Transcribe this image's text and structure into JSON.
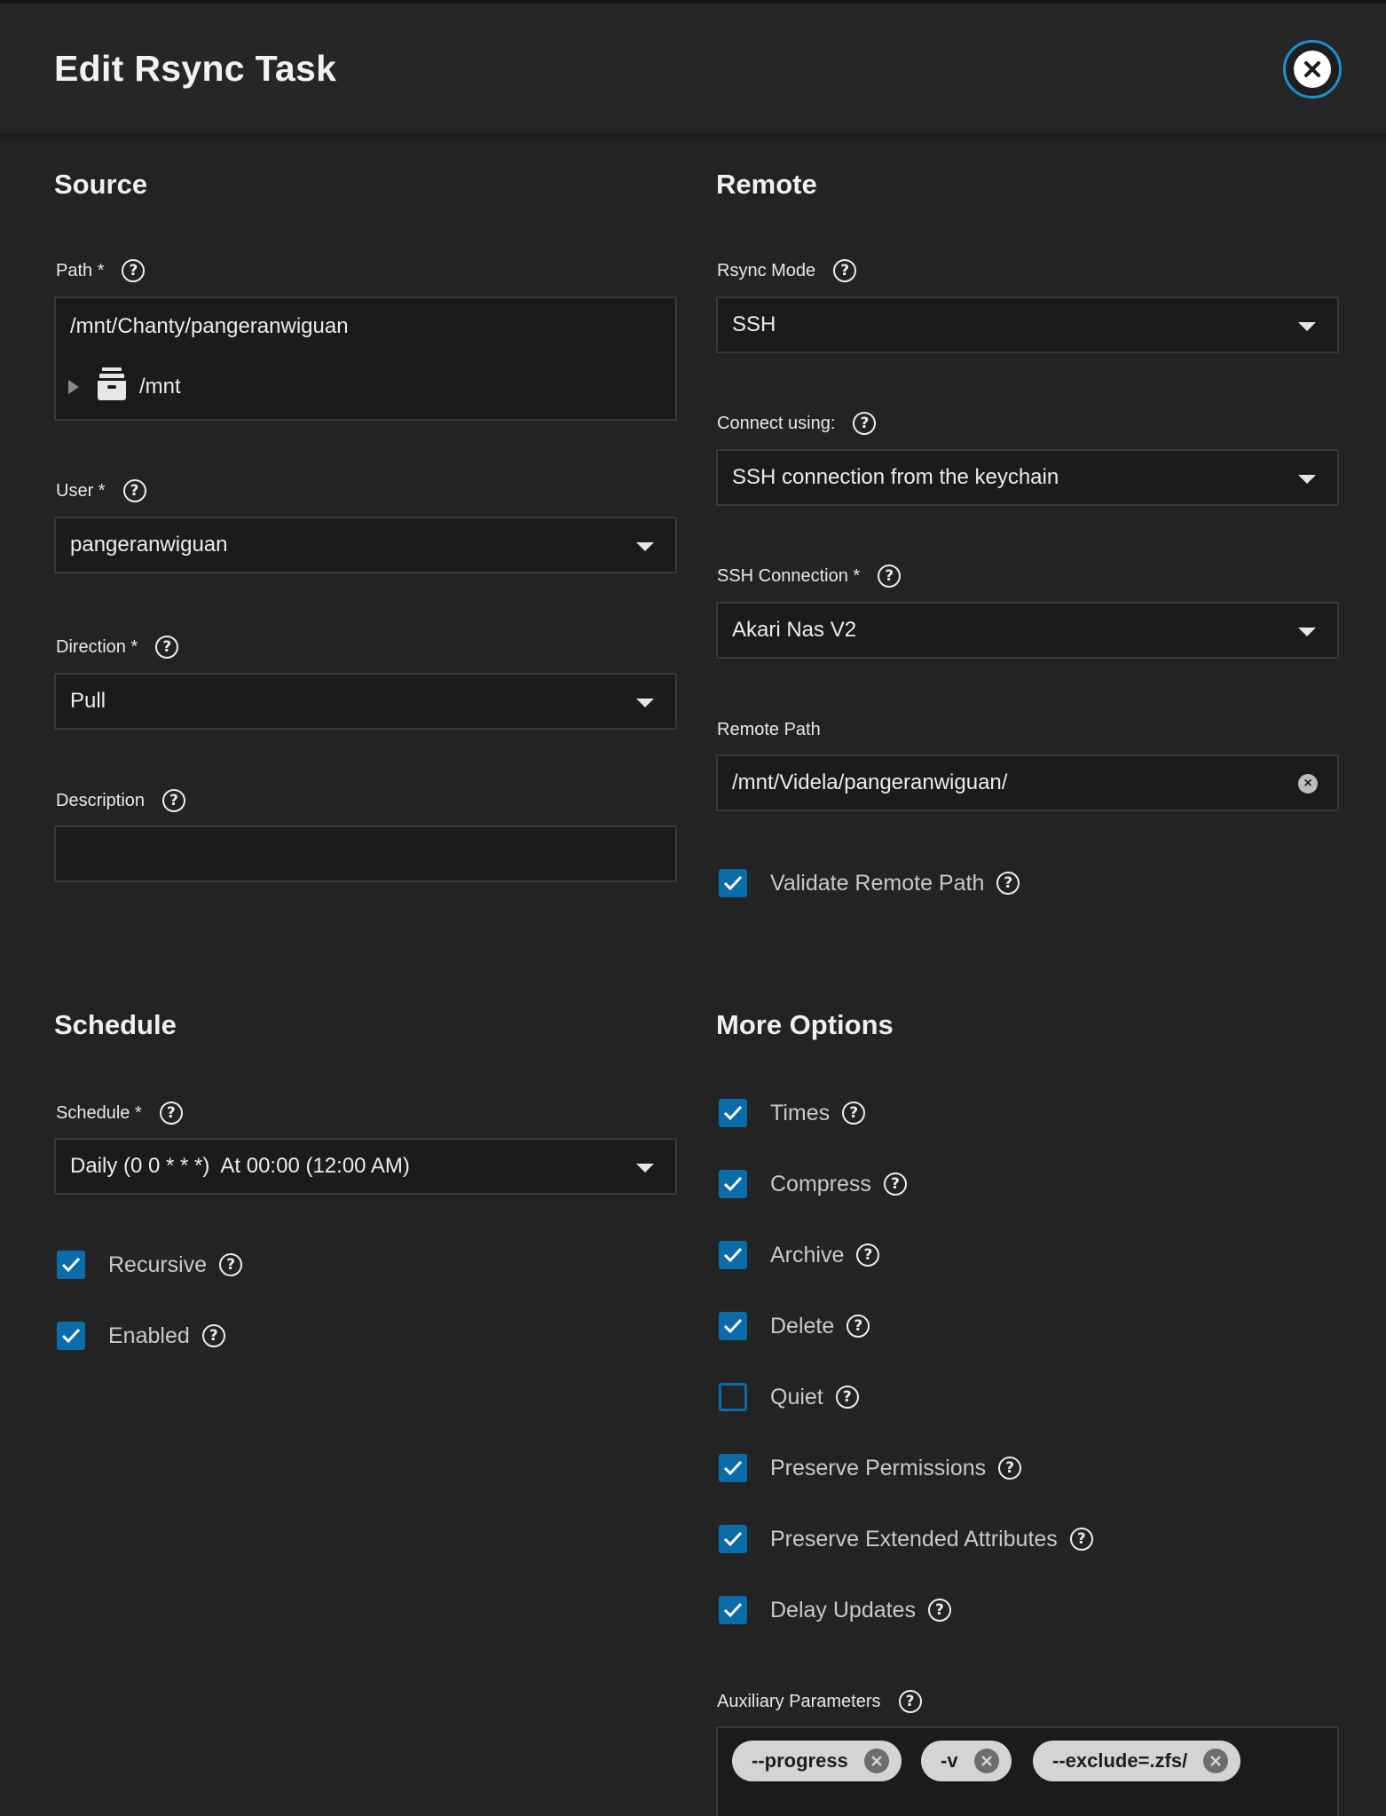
{
  "header": {
    "title": "Edit Rsync Task"
  },
  "source": {
    "title": "Source",
    "path_label": "Path *",
    "path_value": "/mnt/Chanty/pangeranwiguan",
    "tree_node": "/mnt",
    "user_label": "User *",
    "user_value": "pangeranwiguan",
    "direction_label": "Direction *",
    "direction_value": "Pull",
    "description_label": "Description",
    "description_value": ""
  },
  "remote": {
    "title": "Remote",
    "mode_label": "Rsync Mode",
    "mode_value": "SSH",
    "connect_label": "Connect using:",
    "connect_value": "SSH connection from the keychain",
    "ssh_conn_label": "SSH Connection *",
    "ssh_conn_value": "Akari Nas V2",
    "remote_path_label": "Remote Path",
    "remote_path_value": "/mnt/Videla/pangeranwiguan/",
    "validate_label": "Validate Remote Path"
  },
  "schedule": {
    "title": "Schedule",
    "schedule_label": "Schedule *",
    "schedule_value": "Daily (0 0 * * *)  At 00:00 (12:00 AM)",
    "recursive_label": "Recursive",
    "enabled_label": "Enabled"
  },
  "more": {
    "title": "More Options",
    "options": [
      {
        "label": "Times",
        "checked": true
      },
      {
        "label": "Compress",
        "checked": true
      },
      {
        "label": "Archive",
        "checked": true
      },
      {
        "label": "Delete",
        "checked": true
      },
      {
        "label": "Quiet",
        "checked": false
      },
      {
        "label": "Preserve Permissions",
        "checked": true
      },
      {
        "label": "Preserve Extended Attributes",
        "checked": true
      },
      {
        "label": "Delay Updates",
        "checked": true
      }
    ],
    "aux_label": "Auxiliary Parameters",
    "aux_chips": [
      "--progress",
      "-v",
      "--exclude=.zfs/"
    ]
  },
  "colors": {
    "accent": "#0a6ca8",
    "close_ring": "#1b8fd1",
    "background": "#232324"
  }
}
